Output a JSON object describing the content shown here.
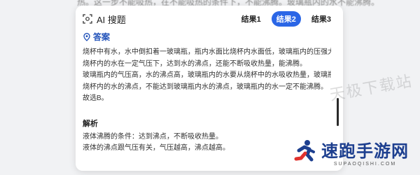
{
  "background_text": "热。这一步不能吸热，在不能吸热的条件下，不能沸腾。玻璃瓶内的水不能沸腾。",
  "header": {
    "title": "AI 搜题",
    "icon": "ai-scan-icon",
    "tabs": [
      {
        "label": "结果1",
        "active": false
      },
      {
        "label": "结果2",
        "active": true
      },
      {
        "label": "结果3",
        "active": false
      }
    ],
    "accent_color": "#2b66e6"
  },
  "answer": {
    "heading": "答案",
    "lines": [
      "烧杯中有水，水中倒扣着一玻璃瓶，瓶内水面比烧杯内水面低，玻璃瓶内的压强大于外界压强。",
      "烧杯内的水在一定气压下，达到水的沸点，还能不断吸收热量，能沸腾。",
      "玻璃瓶内的气压高，水的沸点高，玻璃瓶内的水要从烧杯中的水吸收热量，玻璃瓶内的水最高达到",
      "烧杯内的水的沸点，不能达到玻璃瓶内水的沸点，玻璃瓶内的水一定不能沸腾。",
      "故选B。"
    ]
  },
  "analysis": {
    "heading": "解析",
    "lines": [
      "液体沸腾的条件：达到沸点，不断吸收热量。",
      "液体的沸点跟气压有关，气压越高，沸点越高。"
    ]
  },
  "watermarks": {
    "site1": "天极下载站",
    "site2_title": "速跑手游网",
    "site2_sub": "SUPAOQISHI.COM"
  }
}
